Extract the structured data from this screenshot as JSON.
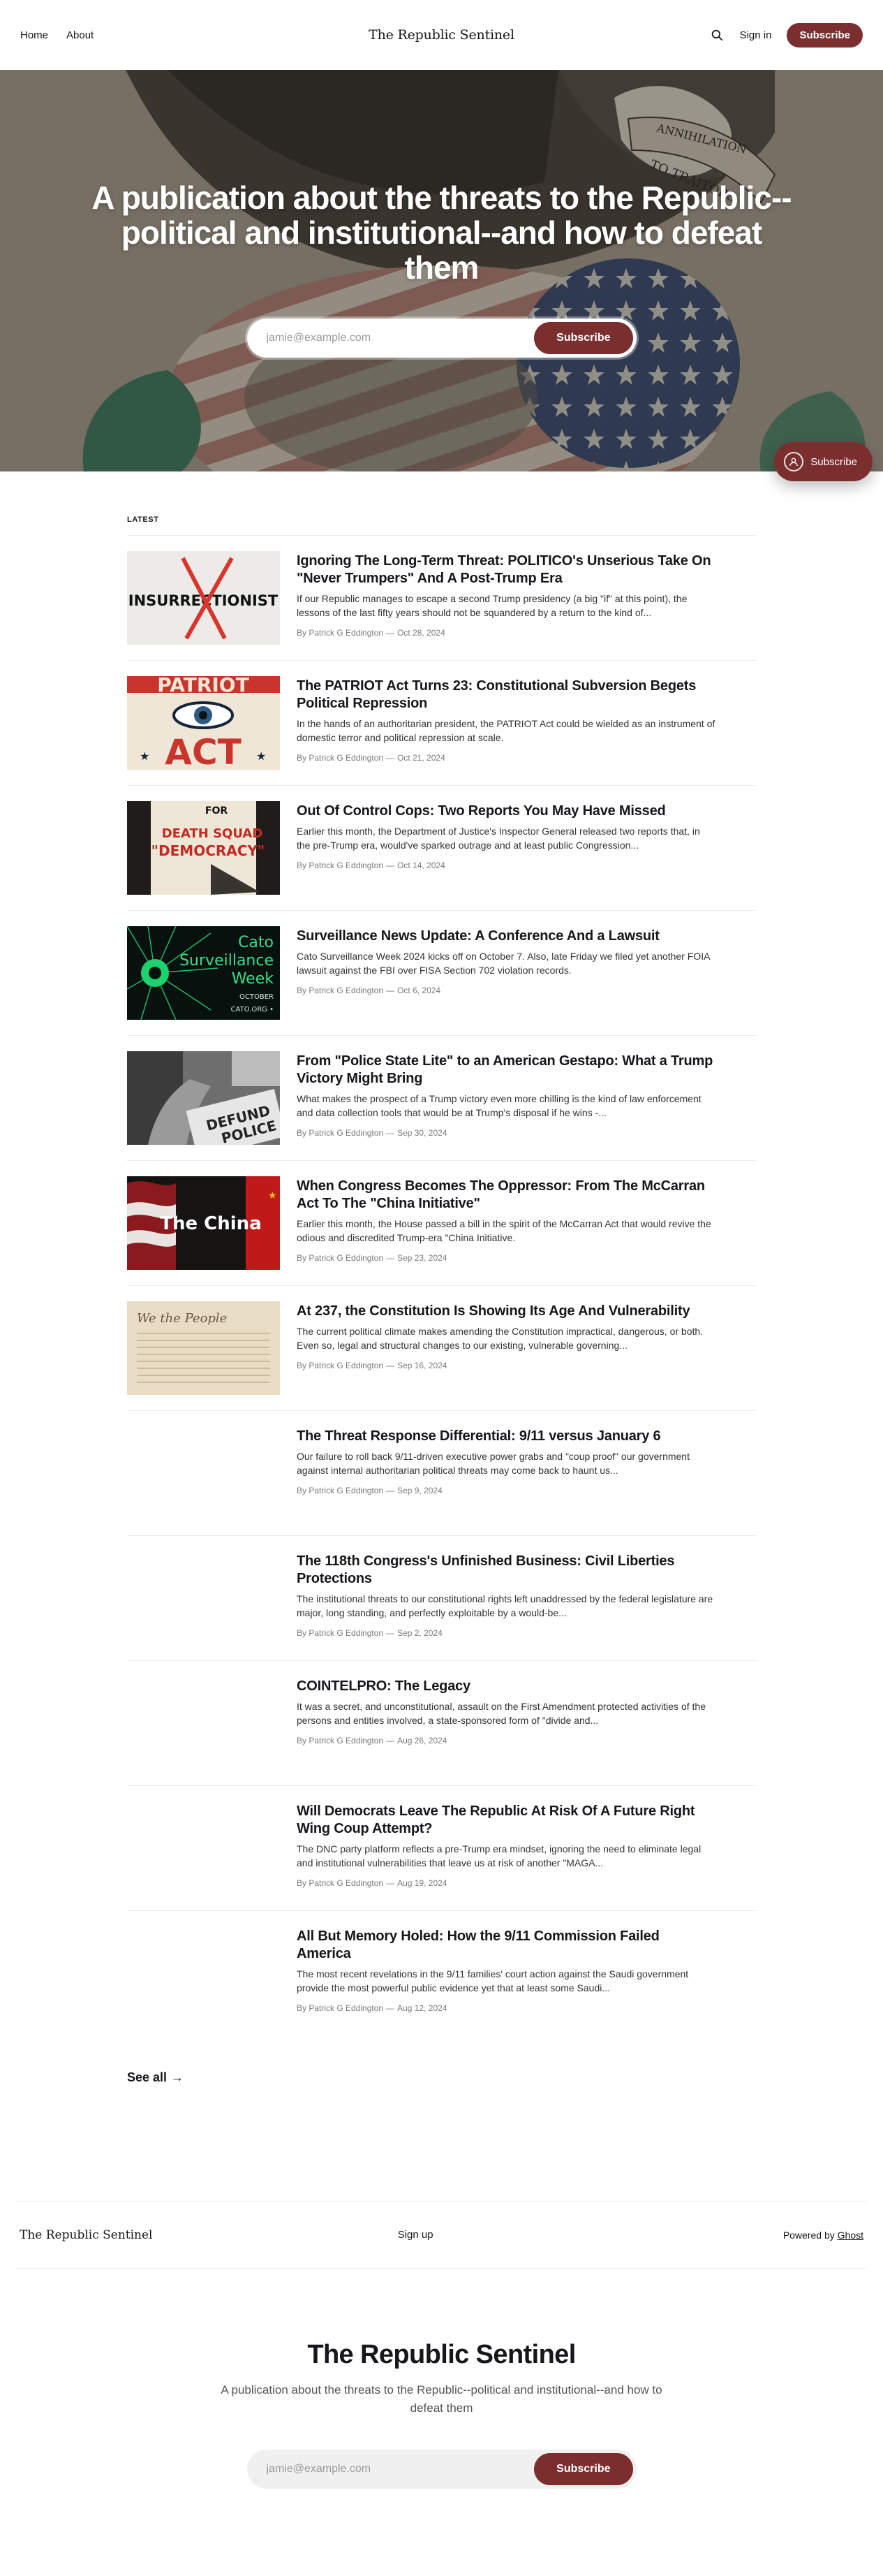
{
  "header": {
    "nav": [
      "Home",
      "About"
    ],
    "brand": "The Republic Sentinel",
    "sign_in": "Sign in",
    "subscribe": "Subscribe"
  },
  "hero": {
    "title": "A publication about the threats to the Republic--political and institutional--and how to defeat them",
    "email_placeholder": "jamie@example.com",
    "subscribe": "Subscribe",
    "banner_text_1": "ANNIHILATION",
    "banner_text_2": "TO TRAITORS"
  },
  "floating_subscribe": "Subscribe",
  "latest_label": "LATEST",
  "posts": [
    {
      "title": "Ignoring The Long-Term Threat: POLITICO's Unserious Take On \"Never Trumpers\" And A Post-Trump Era",
      "excerpt": "If our Republic manages to escape a second Trump presidency (a big \"if\" at this point), the lessons of the last fifty years should not be squandered by a return to the kind of...",
      "author": "By Patrick G Eddington",
      "date": "Oct 28, 2024",
      "thumb": "insurrectionist",
      "thumb_text": "INSURRECTIONIST"
    },
    {
      "title": "The PATRIOT Act Turns 23: Constitutional Subversion Begets Political Repression",
      "excerpt": "In the hands of an authoritarian president, the PATRIOT Act could be wielded as an instrument of domestic terror and political repression at scale.",
      "author": "By Patrick G Eddington",
      "date": "Oct 21, 2024",
      "thumb": "patriot-act",
      "thumb_text": "PATRIOT ACT"
    },
    {
      "title": "Out Of Control Cops: Two Reports You May Have Missed",
      "excerpt": "Earlier this month, the Department of Justice's Inspector General released two reports that, in the pre-Trump era, would've sparked outrage and at least public Congression...",
      "author": "By Patrick G Eddington",
      "date": "Oct 14, 2024",
      "thumb": "death-squad",
      "thumb_text": "FOR DEATH SQUAD \"DEMOCRACY\""
    },
    {
      "title": "Surveillance News Update: A Conference And a Lawsuit",
      "excerpt": "Cato Surveillance Week 2024 kicks off on October 7. Also, late Friday we filed yet another FOIA lawsuit against the FBI over FISA Section 702 violation records.",
      "author": "By Patrick G Eddington",
      "date": "Oct 6, 2024",
      "thumb": "surveillance-week",
      "thumb_text": "Cato Surveillance Week OCTOBER CATO.ORG"
    },
    {
      "title": "From \"Police State Lite\" to an American Gestapo: What a Trump Victory Might Bring",
      "excerpt": "What makes the prospect of a Trump victory even more chilling is the kind of law enforcement and data collection tools that would be at Trump's disposal if he wins -...",
      "author": "By Patrick G Eddington",
      "date": "Sep 30, 2024",
      "thumb": "defund-police",
      "thumb_text": "DEFUND POLICE"
    },
    {
      "title": "When Congress Becomes The Oppressor: From The McCarran Act To The \"China Initiative\"",
      "excerpt": "Earlier this month, the House passed a bill in the spirit of the McCarran Act that would revive the odious and discredited Trump-era \"China Initiative.",
      "author": "By Patrick G Eddington",
      "date": "Sep 23, 2024",
      "thumb": "china-initiative",
      "thumb_text": "The China"
    },
    {
      "title": "At 237, the Constitution Is Showing Its Age And Vulnerability",
      "excerpt": "The current political climate makes amending the Constitution impractical, dangerous, or both. Even so, legal and structural changes to our existing, vulnerable governing...",
      "author": "By Patrick G Eddington",
      "date": "Sep 16, 2024",
      "thumb": "constitution",
      "thumb_text": "We the People"
    },
    {
      "title": "The Threat Response Differential: 9/11 versus January 6",
      "excerpt": "Our failure to roll back 9/11-driven executive power grabs and \"coup proof\" our government against internal authoritarian political threats may come back to haunt us...",
      "author": "By Patrick G Eddington",
      "date": "Sep 9, 2024",
      "thumb": "none",
      "thumb_text": ""
    },
    {
      "title": "The 118th Congress's Unfinished Business: Civil Liberties Protections",
      "excerpt": "The institutional threats to our constitutional rights left unaddressed by the federal legislature are major, long standing, and perfectly exploitable by a would-be...",
      "author": "By Patrick G Eddington",
      "date": "Sep 2, 2024",
      "thumb": "none",
      "thumb_text": ""
    },
    {
      "title": "COINTELPRO: The Legacy",
      "excerpt": "It was a secret, and unconstitutional, assault on the First Amendment protected activities of the persons and entities involved, a state-sponsored form of \"divide and...",
      "author": "By Patrick G Eddington",
      "date": "Aug 26, 2024",
      "thumb": "none",
      "thumb_text": ""
    },
    {
      "title": "Will Democrats Leave The Republic At Risk Of A Future Right Wing Coup Attempt?",
      "excerpt": "The DNC party platform reflects a pre-Trump era mindset, ignoring the need to eliminate legal and institutional vulnerabilities that leave us at risk of another \"MAGA...",
      "author": "By Patrick G Eddington",
      "date": "Aug 19, 2024",
      "thumb": "none",
      "thumb_text": ""
    },
    {
      "title": "All But Memory Holed: How the 9/11 Commission Failed America",
      "excerpt": "The most recent revelations in the 9/11 families' court action against the Saudi government provide the most powerful public evidence yet that at least some Saudi...",
      "author": "By Patrick G Eddington",
      "date": "Aug 12, 2024",
      "thumb": "none",
      "thumb_text": ""
    }
  ],
  "see_all": "See all",
  "footer": {
    "brand": "The Republic Sentinel",
    "sign_up": "Sign up",
    "powered_prefix": "Powered by",
    "powered_link": "Ghost"
  },
  "footer_cta": {
    "title": "The Republic Sentinel",
    "description": "A publication about the threats to the Republic--political and institutional--and how to defeat them",
    "email_placeholder": "jamie@example.com",
    "subscribe": "Subscribe"
  },
  "colors": {
    "accent": "#7a2e2e",
    "text": "#15171a",
    "meta": "#7b7b7b",
    "divider": "#ececec"
  }
}
